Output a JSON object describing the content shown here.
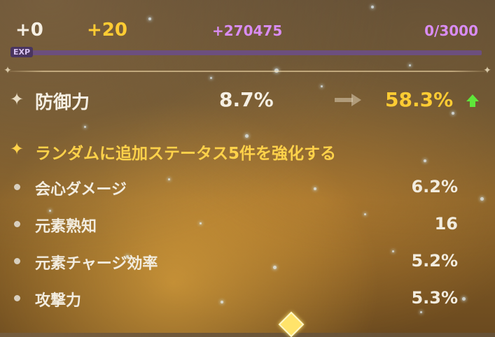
{
  "header": {
    "level_gain": "+0",
    "level_gain_next": "+20",
    "exp_gain": "+270475",
    "exp_progress": "0/3000",
    "exp_label": "EXP",
    "exp_fill_fraction": 0.0
  },
  "main_stat": {
    "name": "防御力",
    "current_value": "8.7%",
    "new_value": "58.3%"
  },
  "substat_section": {
    "title": "ランダムに追加ステータス5件を強化する",
    "items": [
      {
        "label": "会心ダメージ",
        "value": "6.2%"
      },
      {
        "label": "元素熟知",
        "value": "16"
      },
      {
        "label": "元素チャージ効率",
        "value": "5.2%"
      },
      {
        "label": "攻撃力",
        "value": "5.3%"
      }
    ]
  },
  "colors": {
    "white_text": "#f5efe3",
    "gold": "#ffcc33",
    "purple": "#d98cf2",
    "green_arrow": "#5fe63a"
  }
}
